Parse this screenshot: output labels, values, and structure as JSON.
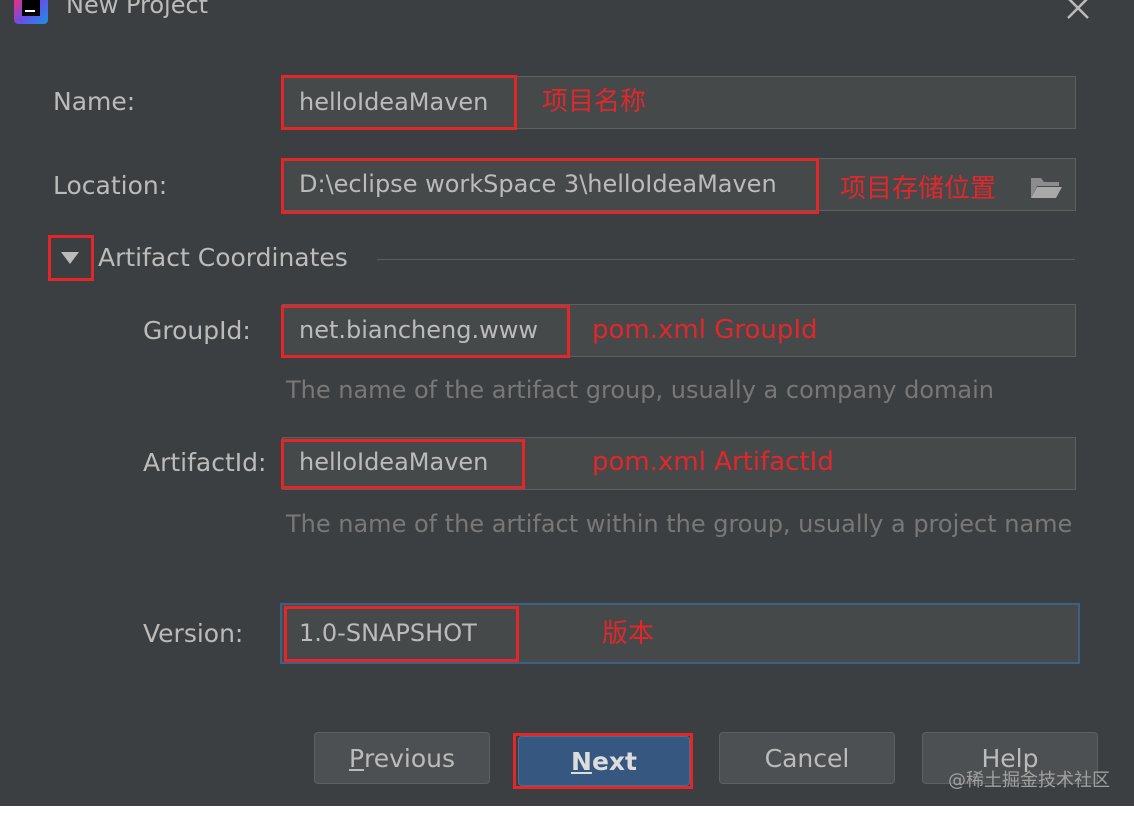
{
  "window": {
    "title": "New Project"
  },
  "form": {
    "name_label": "Name:",
    "name_value": "helloIdeaMaven",
    "name_note": "项目名称",
    "location_label": "Location:",
    "location_value": "D:\\eclipse workSpace 3\\helloIdeaMaven",
    "location_note": "项目存储位置",
    "section_title": "Artifact Coordinates",
    "groupid_label": "GroupId:",
    "groupid_value": "net.biancheng.www",
    "groupid_note": "pom.xml GroupId",
    "groupid_hint": "The name of the artifact group, usually a company domain",
    "artifactid_label": "ArtifactId:",
    "artifactid_value": "helloIdeaMaven",
    "artifactid_note": "pom.xml ArtifactId",
    "artifactid_hint": "The name of the artifact within the group, usually a project name",
    "version_label": "Version:",
    "version_value": "1.0-SNAPSHOT",
    "version_note": "版本"
  },
  "buttons": {
    "previous_mnemonic": "P",
    "previous_rest": "revious",
    "next_mnemonic": "N",
    "next_rest": "ext",
    "cancel": "Cancel",
    "help": "Help"
  },
  "watermark": "@稀土掘金技术社区",
  "icons": {
    "close": "close-icon",
    "folder": "folder-icon",
    "collapse": "triangle-down-icon",
    "app": "intellij-idea-icon"
  },
  "colors": {
    "background": "#3c3f41",
    "field": "#45494a",
    "annotation_red": "#e2272b",
    "primary_button": "#365880",
    "focus_border": "#3d6185"
  }
}
